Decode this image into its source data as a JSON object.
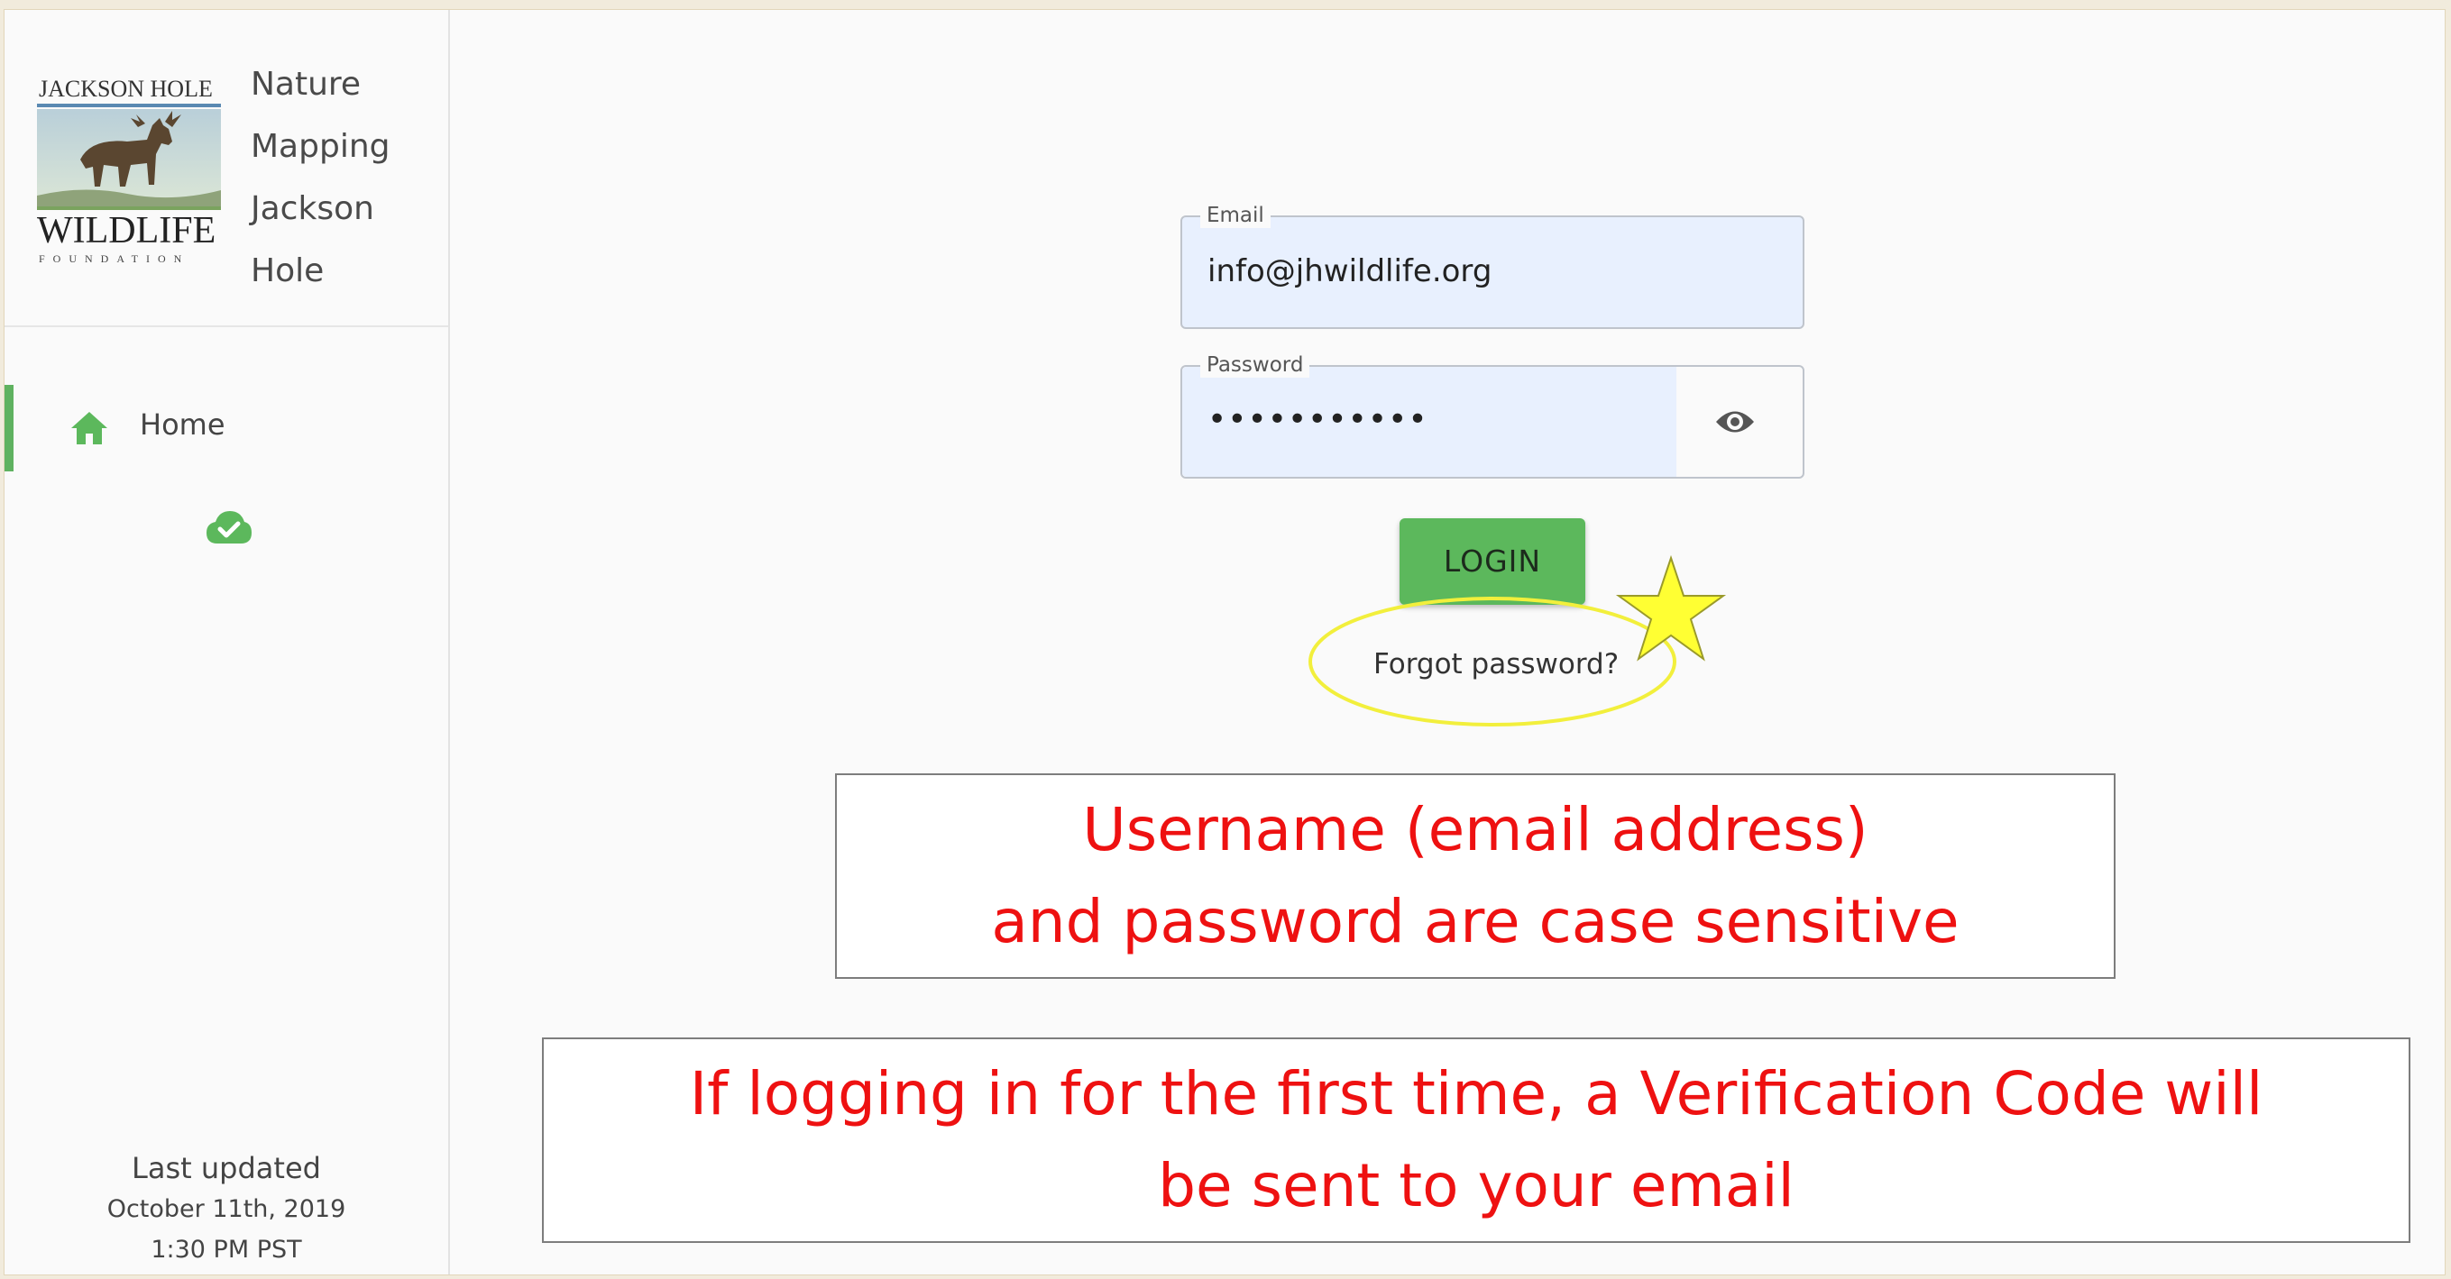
{
  "sidebar": {
    "logo": {
      "top_text": "JACKSON HOLE",
      "main_text": "WILDLIFE",
      "sub_text": "FOUNDATION"
    },
    "brand_lines": [
      "Nature",
      "Mapping",
      "Jackson",
      "Hole"
    ],
    "nav": {
      "home_label": "Home",
      "home_icon": "home-icon",
      "sync_icon": "cloud-check-icon"
    },
    "last_updated": {
      "label": "Last updated",
      "date": "October 11th, 2019",
      "time": "1:30 PM PST"
    }
  },
  "login": {
    "email_label": "Email",
    "email_value": "info@jhwildlife.org",
    "password_label": "Password",
    "password_masked": "•••••••••••",
    "toggle_icon": "eye-icon",
    "login_button": "LOGIN",
    "forgot_link": "Forgot password?"
  },
  "annotations": {
    "note1": {
      "line1": "Username (email address)",
      "line2": "and password are case sensitive"
    },
    "note2": {
      "line1": "If logging in for the first time, a Verification Code will",
      "line2": "be sent to your email"
    },
    "highlight_color": "#ffff33",
    "note_text_color": "#ee1111"
  },
  "colors": {
    "accent_green": "#5cb85c",
    "autofill_blue": "#e8f0fe"
  }
}
